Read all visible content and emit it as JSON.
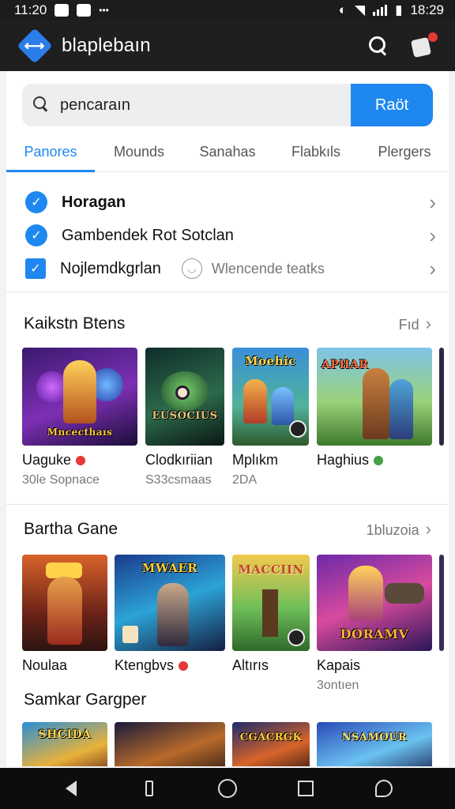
{
  "status_bar": {
    "time_left": "11:20",
    "time_right": "18:29"
  },
  "app_bar": {
    "title": "blaplebaın"
  },
  "search": {
    "value": "pencaraın",
    "button_label": "Raöt"
  },
  "tabs": [
    {
      "label": "Panores",
      "active": true
    },
    {
      "label": "Mounds"
    },
    {
      "label": "Sanahas"
    },
    {
      "label": "Flabkıls"
    },
    {
      "label": "Plergers"
    }
  ],
  "filters": {
    "row1": "Horagan",
    "row2": "Gambendek Rot Sotclan",
    "row3": "Nojlemdkgrlan",
    "row3_note": "Wlencende teatks"
  },
  "section1": {
    "title": "Kaikstn Btens",
    "link": "Fıd",
    "cards": [
      {
        "title": "Uaguke",
        "sub": "30le Sopnace",
        "art": "Mncecthaıs"
      },
      {
        "title": "Clodkıriian",
        "sub": "S33csmaas",
        "art": "EUSOCIUS"
      },
      {
        "title": "Mplıkm",
        "sub": "2DA",
        "art": "Moehic"
      },
      {
        "title": "Haghius",
        "sub": "",
        "art": "APHAR"
      }
    ]
  },
  "section2": {
    "title": "Bartha Gane",
    "link": "1bluzoia",
    "cards": [
      {
        "title": "Noulaa",
        "sub": "",
        "art": ""
      },
      {
        "title": "Ktengbvs",
        "sub": "",
        "art": "MWAER"
      },
      {
        "title": "Altırıs",
        "sub": "",
        "art": "MACCIIN"
      },
      {
        "title": "Kapais",
        "sub": "3ontıen",
        "art": "DORAMV"
      }
    ]
  },
  "section3": {
    "title": "Samkar Gargper",
    "cards": [
      {
        "art": "SHCIDA"
      },
      {
        "art": ""
      },
      {
        "art": "CGACRGK"
      },
      {
        "art": "NSAMOUR"
      }
    ]
  },
  "colors": {
    "accent": "#1e88f0",
    "badge_red": "#e53935",
    "badge_green": "#43a047",
    "app_bar": "#1f1f1f"
  },
  "icons": [
    "diamond-logo-icon",
    "search-icon",
    "profile-dice-icon",
    "chevron-right-icon",
    "check-icon",
    "face-icon",
    "back-icon",
    "home-icon",
    "recents-icon",
    "assistant-icon"
  ]
}
